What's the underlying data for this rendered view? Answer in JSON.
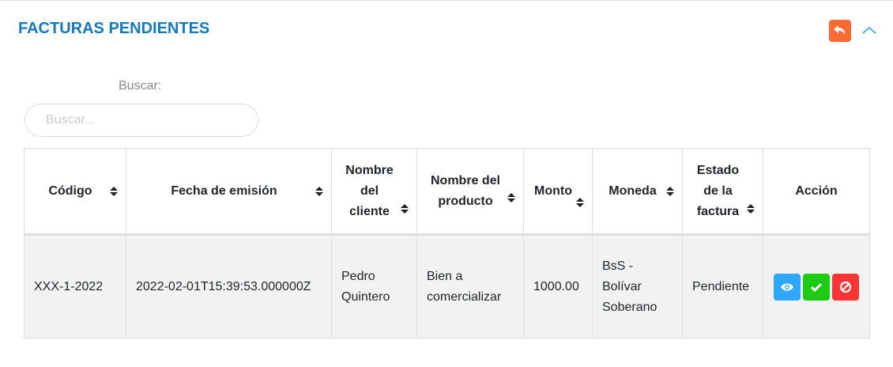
{
  "header": {
    "title": "FACTURAS PENDIENTES",
    "back_color": "#ff6a32",
    "title_color": "#1479bd"
  },
  "search": {
    "label": "Buscar:",
    "placeholder": "Buscar...",
    "value": ""
  },
  "table": {
    "columns": [
      "Código",
      "Fecha de emisión",
      "Nombre del cliente",
      "Nombre del producto",
      "Monto",
      "Moneda",
      "Estado de la factura",
      "Acción"
    ],
    "rows": [
      {
        "codigo": "XXX-1-2022",
        "fecha": "2022-02-01T15:39:53.000000Z",
        "cliente": "Pedro Quintero",
        "producto": "Bien a comercializar",
        "monto": "1000.00",
        "moneda": "BsS - Bolívar Soberano",
        "estado": "Pendiente"
      }
    ]
  },
  "actions": {
    "view_color": "#2ea7ff",
    "approve_color": "#1ecb14",
    "reject_color": "#ff3535"
  }
}
